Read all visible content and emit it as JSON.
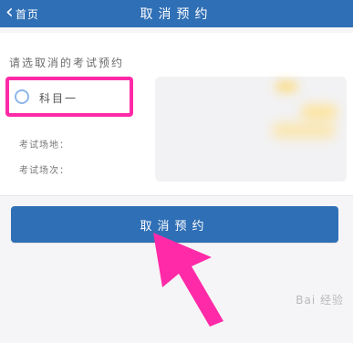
{
  "header": {
    "back_label": "首页",
    "title": "取消预约"
  },
  "main": {
    "section_title": "请选取消的考试预约",
    "subject_label": "科目一",
    "exam_location_label": "考试场地：",
    "exam_session_label": "考试场次："
  },
  "actions": {
    "cancel_button_label": "取消预约"
  },
  "watermark": {
    "text": "Bai 经验"
  },
  "colors": {
    "header_blue": "#2f6fb6",
    "annotation_pink": "#ff2aa7",
    "radio_blue": "#8db7ea"
  },
  "icons": {
    "back": "chevron-left-icon",
    "radio": "radio-button-icon",
    "arrow": "annotation-arrow-icon"
  }
}
